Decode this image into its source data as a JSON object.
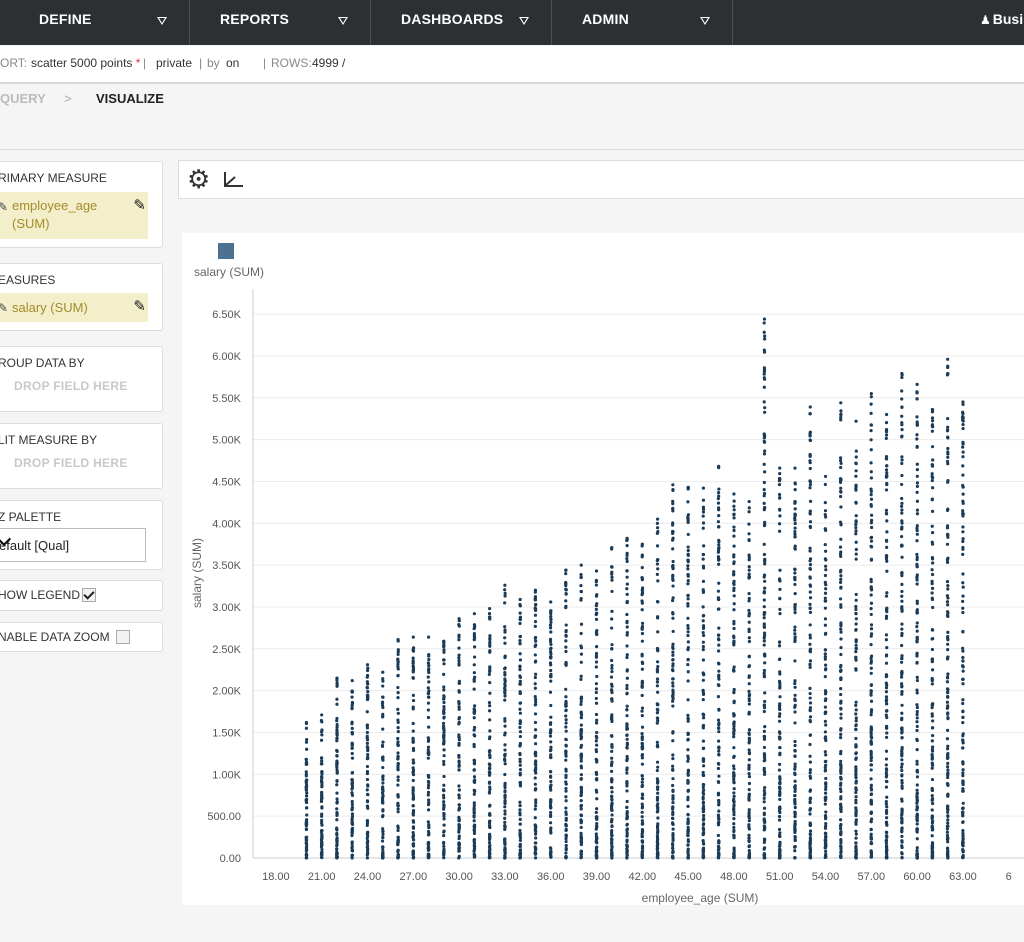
{
  "nav": {
    "items": [
      {
        "label": "DEFINE"
      },
      {
        "label": "REPORTS"
      },
      {
        "label": "DASHBOARDS"
      },
      {
        "label": "ADMIN"
      }
    ],
    "user_label": "Busi"
  },
  "infobar": {
    "report_prefix": "ORT:",
    "report_name": "scatter 5000 points",
    "required_mark": "*",
    "visibility": "private",
    "by_label": "by",
    "on_label": "on",
    "rows_label": "ROWS:",
    "rows_value": "4999 /"
  },
  "breadcrumb": {
    "query": "QUERY",
    "separator": ">",
    "visualize": "VISUALIZE"
  },
  "left_panel": {
    "primary_measure": {
      "title": "RIMARY MEASURE",
      "field_line1": "employee_age",
      "field_line2": "(SUM)"
    },
    "measures": {
      "title": "EASURES",
      "field": "salary (SUM)"
    },
    "group_by": {
      "title": "ROUP DATA BY",
      "drop": "DROP FIELD HERE"
    },
    "split_by": {
      "title": "LIT MEASURE BY",
      "drop": "DROP FIELD HERE"
    },
    "palette": {
      "title": "Z PALETTE",
      "selected": "efault [Qual]"
    },
    "show_legend": {
      "label": "HOW LEGEND",
      "checked": true
    },
    "data_zoom": {
      "label": "NABLE DATA ZOOM",
      "checked": false
    }
  },
  "toolbar": {
    "settings_icon": "gear-icon",
    "axis_icon": "axis-icon"
  },
  "colors": {
    "point": "#1b3b57",
    "legend_swatch": "#4e7190",
    "nav_bg": "#2c3033",
    "field_bg": "#f4efcb"
  },
  "chart_data": {
    "type": "scatter",
    "legend": [
      "salary (SUM)"
    ],
    "legend_position": "top-left",
    "xlabel": "employee_age (SUM)",
    "ylabel": "salary (SUM)",
    "xlim": [
      16.5,
      67
    ],
    "ylim": [
      0,
      6800
    ],
    "grid": "horizontal",
    "x_ticks": [
      "18.00",
      "21.00",
      "24.00",
      "27.00",
      "30.00",
      "33.00",
      "36.00",
      "39.00",
      "42.00",
      "45.00",
      "48.00",
      "51.00",
      "54.00",
      "57.00",
      "60.00",
      "63.00",
      "6"
    ],
    "y_ticks": [
      "0.00",
      "500.00",
      "1.00K",
      "1.50K",
      "2.00K",
      "2.50K",
      "3.00K",
      "3.50K",
      "4.00K",
      "4.50K",
      "5.00K",
      "5.50K",
      "6.00K",
      "6.50K"
    ],
    "series": [
      {
        "name": "salary (SUM)",
        "x_values_from": 20,
        "x_step": 1,
        "max_salary_per_age": [
          1620,
          1710,
          2150,
          2120,
          2310,
          2220,
          2610,
          2640,
          2640,
          2590,
          2860,
          2920,
          2980,
          3260,
          3090,
          3200,
          3060,
          3440,
          3500,
          3430,
          3710,
          3820,
          3750,
          4050,
          4460,
          4430,
          4420,
          4680,
          4350,
          4260,
          6440,
          4660,
          4660,
          5390,
          4560,
          5440,
          5220,
          5550,
          5300,
          5790,
          5660,
          5360,
          5960,
          5450
        ]
      }
    ],
    "points_shown": 4999,
    "density_note": "points fill the range from 0 up to each age's max salary"
  }
}
